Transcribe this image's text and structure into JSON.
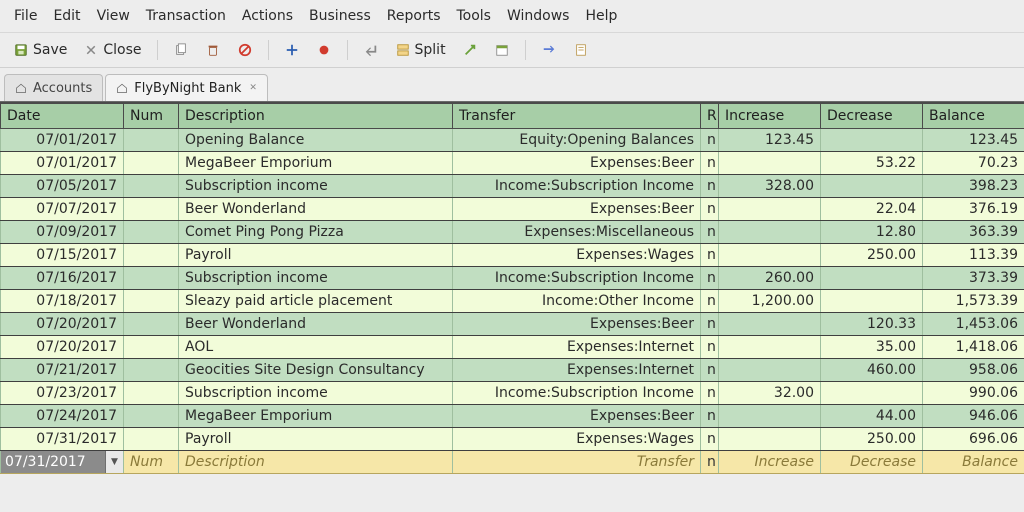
{
  "menu": [
    "File",
    "Edit",
    "View",
    "Transaction",
    "Actions",
    "Business",
    "Reports",
    "Tools",
    "Windows",
    "Help"
  ],
  "toolbar": {
    "save": "Save",
    "close": "Close",
    "split": "Split"
  },
  "tabs": {
    "accounts": "Accounts",
    "active": "FlyByNight Bank"
  },
  "columns": {
    "date": "Date",
    "num": "Num",
    "desc": "Description",
    "xfer": "Transfer",
    "r": "R",
    "inc": "Increase",
    "dec": "Decrease",
    "bal": "Balance"
  },
  "rows": [
    {
      "date": "07/01/2017",
      "num": "",
      "desc": "Opening Balance",
      "xfer": "Equity:Opening Balances",
      "r": "n",
      "inc": "123.45",
      "dec": "",
      "bal": "123.45"
    },
    {
      "date": "07/01/2017",
      "num": "",
      "desc": "MegaBeer Emporium",
      "xfer": "Expenses:Beer",
      "r": "n",
      "inc": "",
      "dec": "53.22",
      "bal": "70.23"
    },
    {
      "date": "07/05/2017",
      "num": "",
      "desc": "Subscription income",
      "xfer": "Income:Subscription Income",
      "r": "n",
      "inc": "328.00",
      "dec": "",
      "bal": "398.23"
    },
    {
      "date": "07/07/2017",
      "num": "",
      "desc": "Beer Wonderland",
      "xfer": "Expenses:Beer",
      "r": "n",
      "inc": "",
      "dec": "22.04",
      "bal": "376.19"
    },
    {
      "date": "07/09/2017",
      "num": "",
      "desc": "Comet Ping Pong Pizza",
      "xfer": "Expenses:Miscellaneous",
      "r": "n",
      "inc": "",
      "dec": "12.80",
      "bal": "363.39"
    },
    {
      "date": "07/15/2017",
      "num": "",
      "desc": "Payroll",
      "xfer": "Expenses:Wages",
      "r": "n",
      "inc": "",
      "dec": "250.00",
      "bal": "113.39"
    },
    {
      "date": "07/16/2017",
      "num": "",
      "desc": "Subscription income",
      "xfer": "Income:Subscription Income",
      "r": "n",
      "inc": "260.00",
      "dec": "",
      "bal": "373.39"
    },
    {
      "date": "07/18/2017",
      "num": "",
      "desc": "Sleazy paid article placement",
      "xfer": "Income:Other Income",
      "r": "n",
      "inc": "1,200.00",
      "dec": "",
      "bal": "1,573.39"
    },
    {
      "date": "07/20/2017",
      "num": "",
      "desc": "Beer Wonderland",
      "xfer": "Expenses:Beer",
      "r": "n",
      "inc": "",
      "dec": "120.33",
      "bal": "1,453.06"
    },
    {
      "date": "07/20/2017",
      "num": "",
      "desc": "AOL",
      "xfer": "Expenses:Internet",
      "r": "n",
      "inc": "",
      "dec": "35.00",
      "bal": "1,418.06"
    },
    {
      "date": "07/21/2017",
      "num": "",
      "desc": "Geocities Site Design Consultancy",
      "xfer": "Expenses:Internet",
      "r": "n",
      "inc": "",
      "dec": "460.00",
      "bal": "958.06"
    },
    {
      "date": "07/23/2017",
      "num": "",
      "desc": "Subscription income",
      "xfer": "Income:Subscription Income",
      "r": "n",
      "inc": "32.00",
      "dec": "",
      "bal": "990.06"
    },
    {
      "date": "07/24/2017",
      "num": "",
      "desc": "MegaBeer Emporium",
      "xfer": "Expenses:Beer",
      "r": "n",
      "inc": "",
      "dec": "44.00",
      "bal": "946.06"
    },
    {
      "date": "07/31/2017",
      "num": "",
      "desc": "Payroll",
      "xfer": "Expenses:Wages",
      "r": "n",
      "inc": "",
      "dec": "250.00",
      "bal": "696.06"
    }
  ],
  "entry": {
    "date": "07/31/2017",
    "num": "Num",
    "desc": "Description",
    "xfer": "Transfer",
    "r": "n",
    "inc": "Increase",
    "dec": "Decrease",
    "bal": "Balance"
  }
}
